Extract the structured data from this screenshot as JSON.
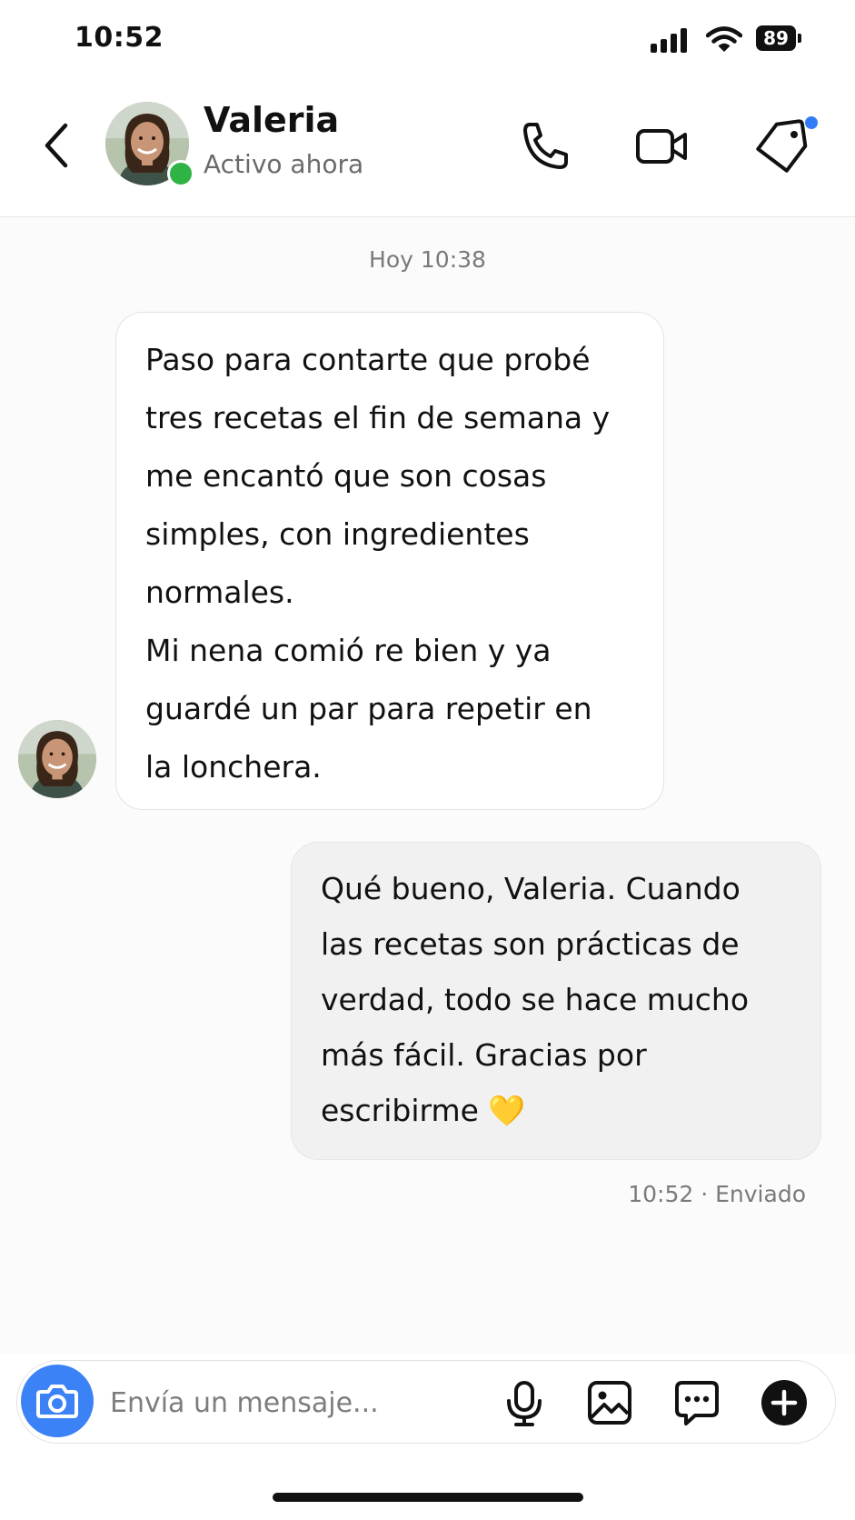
{
  "status_bar": {
    "time": "10:52",
    "battery": "89"
  },
  "header": {
    "back_icon": "chevron-left-icon",
    "contact_name": "Valeria",
    "contact_status": "Activo ahora",
    "actions": [
      "phone-icon",
      "video-camera-icon",
      "tag-icon"
    ],
    "colors": {
      "online": "#2fb344",
      "notification": "#2f7cf6"
    }
  },
  "chat": {
    "date_label": "Hoy 10:38",
    "messages": [
      {
        "direction": "incoming",
        "text": "Paso para contarte que probé\ntres recetas el fin de semana y\nme encantó que son cosas\nsimples, con ingredientes\nnormales.\nMi nena comió re bien y ya\nguardé un par para repetir en\nla lonchera."
      },
      {
        "direction": "outgoing",
        "text": "Qué bueno, Valeria. Cuando\nlas recetas son prácticas de\nverdad, todo se hace mucho\nmás fácil. Gracias por\nescribirme 💛"
      }
    ],
    "sent_meta": "10:52 · Enviado"
  },
  "composer": {
    "placeholder": "Envía un mensaje...",
    "icons": [
      "camera-icon",
      "microphone-icon",
      "image-icon",
      "chat-bubble-icon",
      "plus-circle-icon"
    ],
    "accent": "#3b82f6"
  }
}
